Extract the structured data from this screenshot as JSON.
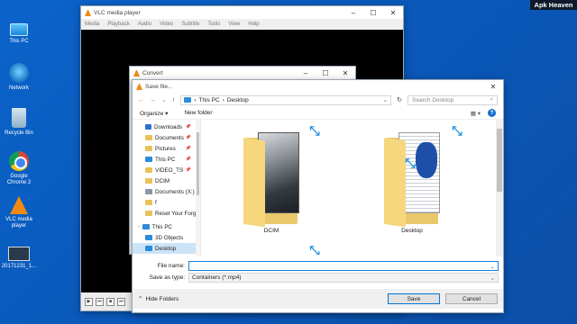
{
  "watermark": "Apk Heaven",
  "desktop": {
    "icons": [
      {
        "label": "This PC",
        "icon": "this-pc-icon"
      },
      {
        "label": "Network",
        "icon": "network-icon"
      },
      {
        "label": "Recycle Bin",
        "icon": "recycle-bin-icon"
      },
      {
        "label": "Google Chrome 2",
        "icon": "chrome-icon"
      },
      {
        "label": "VLC media player",
        "icon": "vlc-icon"
      },
      {
        "label": "20171231_1...",
        "icon": "video-file-icon"
      }
    ]
  },
  "vlc": {
    "title": "VLC media player",
    "menu": [
      "Media",
      "Playback",
      "Audio",
      "Video",
      "Subtitle",
      "Tools",
      "View",
      "Help"
    ],
    "time": "--:--"
  },
  "convert": {
    "title": "Convert"
  },
  "save_dialog": {
    "title": "Save file...",
    "breadcrumb": [
      "This PC",
      "Desktop"
    ],
    "search_placeholder": "Search Desktop",
    "toolbar": {
      "organize": "Organize",
      "new_folder": "New folder"
    },
    "nav": [
      {
        "label": "Downloads",
        "pinned": true,
        "icon": "downloads-icon"
      },
      {
        "label": "Documents",
        "pinned": true,
        "icon": "folder-icon"
      },
      {
        "label": "Pictures",
        "pinned": true,
        "icon": "folder-icon"
      },
      {
        "label": "This PC",
        "pinned": true,
        "icon": "this-pc-icon"
      },
      {
        "label": "VIDEO_TS",
        "pinned": true,
        "icon": "folder-icon"
      },
      {
        "label": "DCIM",
        "pinned": false,
        "icon": "folder-icon"
      },
      {
        "label": "Documents (X:)",
        "pinned": false,
        "icon": "drive-icon"
      },
      {
        "label": "f",
        "pinned": false,
        "icon": "folder-icon"
      },
      {
        "label": "Reset Your Forgo",
        "pinned": false,
        "icon": "folder-icon"
      },
      {
        "label": "This PC",
        "pinned": false,
        "icon": "this-pc-icon"
      },
      {
        "label": "3D Objects",
        "pinned": false,
        "icon": "folder-icon"
      },
      {
        "label": "Desktop",
        "pinned": false,
        "icon": "folder-icon",
        "selected": true
      }
    ],
    "items": [
      {
        "name": "DCIM"
      },
      {
        "name": "Desktop"
      }
    ],
    "file_name_label": "File name:",
    "file_name_value": "",
    "save_as_type_label": "Save as type:",
    "save_as_type_value": "Containers (*.mp4)",
    "hide_folders": "Hide Folders",
    "save_button": "Save",
    "cancel_button": "Cancel"
  }
}
